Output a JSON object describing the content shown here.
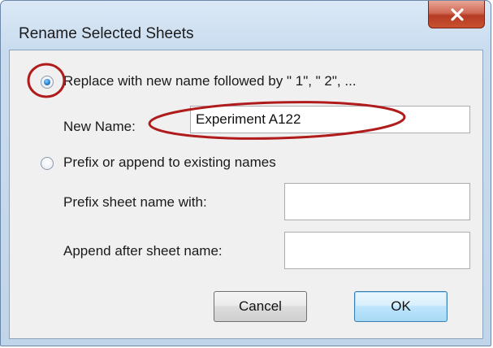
{
  "window": {
    "title": "Rename Selected Sheets",
    "close_glyph": "X"
  },
  "options": {
    "replace_label": "Replace with new name followed by \" 1\", \" 2\", ...",
    "replace_selected": true,
    "prefix_append_label": "Prefix or append to existing names",
    "prefix_append_selected": false
  },
  "new_name": {
    "label": "New Name:",
    "value": "Experiment A122"
  },
  "prefix": {
    "label": "Prefix sheet name with:",
    "value": ""
  },
  "append": {
    "label": "Append after sheet name:",
    "value": ""
  },
  "buttons": {
    "cancel_label": "Cancel",
    "ok_label": "OK"
  },
  "colors": {
    "annotation": "#b01c1c",
    "radio_selected": "#2a7fd0"
  }
}
